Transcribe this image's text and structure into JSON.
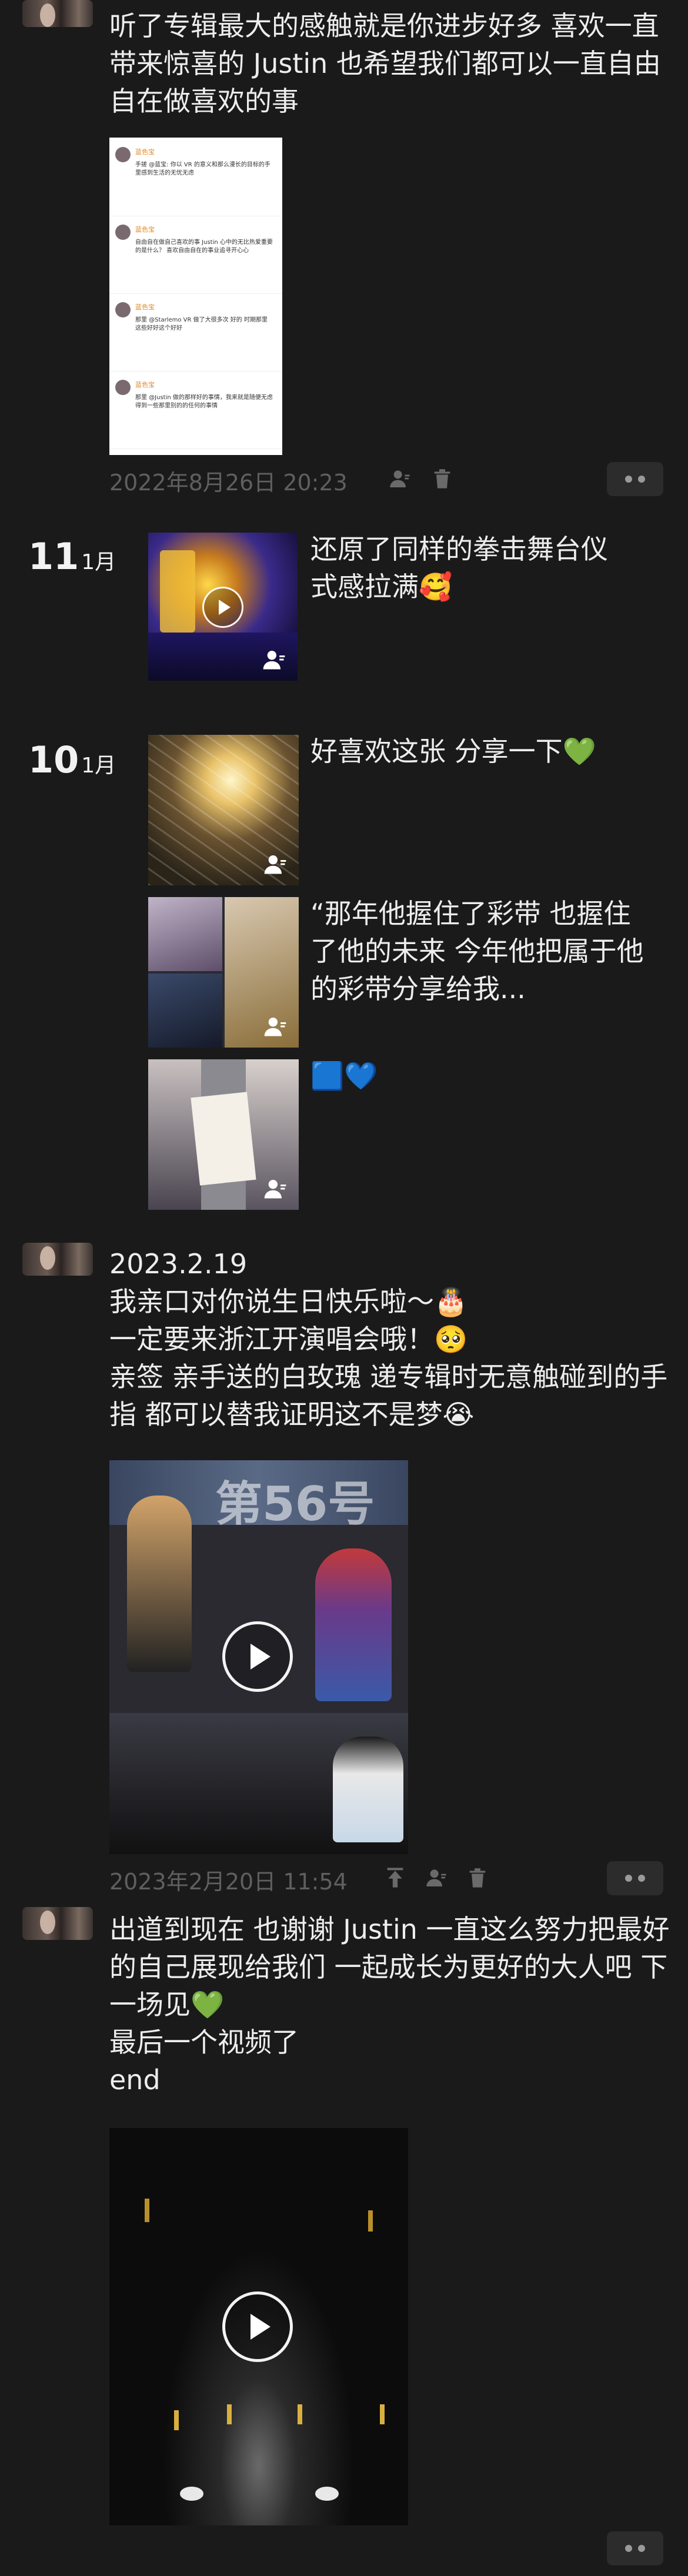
{
  "posts": [
    {
      "text": "听了专辑最大的感触就是你进步好多 喜欢一直带来惊喜的 Justin 也希望我们都可以一直自由自在做喜欢的事",
      "timestamp": "2022年8月26日 20:23",
      "screenshot_comments": [
        {
          "name": "蓝色宝",
          "reply": "手搓 @蓝宝: 你以 VR 的意义和那么漫长的目标的手里感到生活的无忧无虑"
        },
        {
          "name": "蓝色宝",
          "reply": "自由自在做自己喜欢的事 Justin 心中的无比热爱重要的是什么？ 喜欢自由自在的事业追寻开心心"
        },
        {
          "name": "蓝色宝",
          "reply": "那里 @Starlemo VR 做了大很多次 好的 时期那里 这些好好这个好好"
        },
        {
          "name": "蓝色宝",
          "reply": "那里 @Justin 做的那样好的事情，我来就是随便无虑得到一些那里别的的任何的事情"
        }
      ]
    },
    {
      "date_day": "11",
      "date_month": "1月",
      "text": "还原了同样的拳击舞台仪式感拉满🥰"
    },
    {
      "date_day": "10",
      "date_month": "1月",
      "entries": [
        {
          "text": "好喜欢这张 分享一下💚"
        },
        {
          "text": "“那年他握住了彩带 也握住了他的未来 今年他把属于他的彩带分享给我..."
        },
        {
          "text": "🟦💙"
        }
      ]
    },
    {
      "text": "2023.2.19\n我亲口对你说生日快乐啦～🎂\n一定要来浙江开演唱会哦！🥺\n亲签 亲手送的白玫瑰 递专辑时无意触碰到的手指 都可以替我证明这不是梦😭",
      "timestamp": "2023年2月20日 11:54",
      "video_banner": "第56号"
    },
    {
      "text": "出道到现在 也谢谢 Justin 一直这么努力把最好的自己展现给我们 一起成长为更好的大人吧 下一场见💚\n最后一个视频了\nend"
    }
  ],
  "icons": {
    "privacy": "person-icon",
    "delete": "trash-icon",
    "pin": "pin-top-icon",
    "more": "more-dots-icon",
    "play": "play-icon"
  },
  "colors": {
    "background": "#1a1a1a",
    "text": "#ededed",
    "meta": "#5f5f5f"
  }
}
